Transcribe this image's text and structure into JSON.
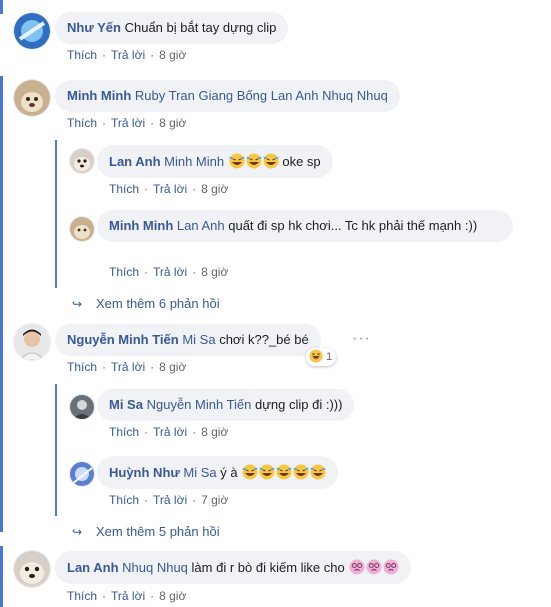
{
  "labels": {
    "like": "Thích",
    "reply": "Trả lời"
  },
  "comments": [
    {
      "author": "Như Yến",
      "mention": "",
      "text": "Chuẩn bị bắt tay dựng clip",
      "time": "8 giờ"
    },
    {
      "author": "Minh Minh",
      "mention": "Ruby Tran Giang Bống Lan Anh Nhuq Nhuq",
      "text": "",
      "time": "8 giờ",
      "replies": [
        {
          "author": "Lan Anh",
          "mention": "Minh Minh",
          "text": "oke sp",
          "emoji": [
            "rofl-emoji",
            "rofl-emoji",
            "rofl-emoji"
          ],
          "time": "8 giờ"
        },
        {
          "author": "Minh Minh",
          "mention": "Lan Anh",
          "text": "quất đi sp hk chơi... Tc hk phải thế mạnh :))",
          "time": "8 giờ"
        }
      ],
      "more_replies": "Xem thêm 6 phản hồi"
    },
    {
      "author": "Nguyễn Minh Tiến",
      "mention": "Mi Sa",
      "text": "chơi k??_bé bé",
      "time": "8 giờ",
      "reaction": {
        "icon": "haha-emoji",
        "count": "1"
      },
      "replies": [
        {
          "author": "Mi Sa",
          "mention": "Nguyễn Minh Tiến",
          "text": "dựng clip đi :)))",
          "time": "8 giờ"
        },
        {
          "author": "Huỳnh Như",
          "mention": "Mi Sa",
          "text": "ý à",
          "emoji": [
            "rofl-emoji",
            "rofl-emoji",
            "rofl-emoji",
            "rofl-emoji",
            "rofl-emoji"
          ],
          "time": "7 giờ"
        }
      ],
      "more_replies": "Xem thêm 5 phản hồi"
    },
    {
      "author": "Lan Anh",
      "mention": "Nhuq Nhuq",
      "text": "làm đi r bò đi kiếm like cho",
      "emoji": [
        "dizzy-face-emoji",
        "dizzy-face-emoji",
        "dizzy-face-emoji"
      ],
      "time": "8 giờ"
    }
  ],
  "colors": {
    "link": "#385898",
    "bubble": "#f0f2f5",
    "thread_bar": "#4a76d8",
    "meta": "#606770"
  }
}
